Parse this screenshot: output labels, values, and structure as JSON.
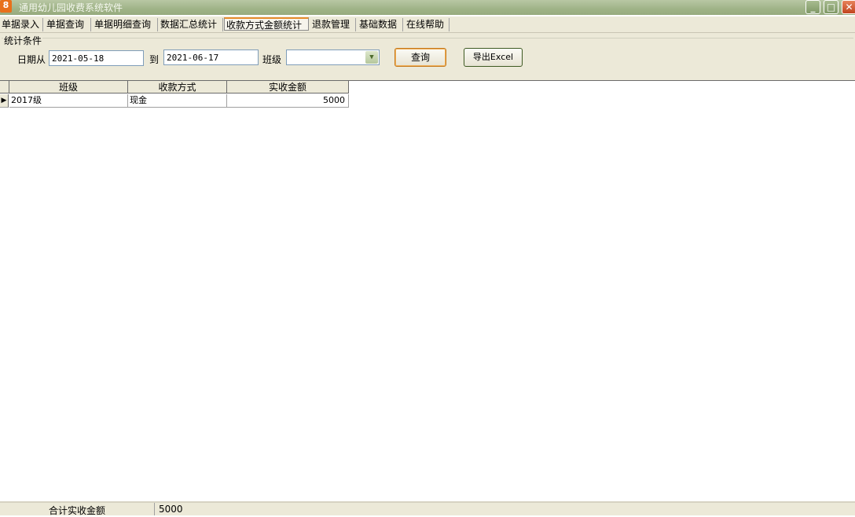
{
  "window": {
    "title": "通用幼儿园收费系统软件",
    "icon_glyph": "8",
    "controls": {
      "minimize": "_",
      "maximize": "□",
      "close": "✕"
    }
  },
  "tabs": [
    {
      "label": "单据录入",
      "active": false
    },
    {
      "label": "单据查询",
      "active": false
    },
    {
      "label": "单据明细查询",
      "active": false
    },
    {
      "label": "数据汇总统计",
      "active": false
    },
    {
      "label": "收款方式金额统计",
      "active": true
    },
    {
      "label": "退款管理",
      "active": false
    },
    {
      "label": "基础数据",
      "active": false
    },
    {
      "label": "在线帮助",
      "active": false
    }
  ],
  "filter": {
    "group_title": "统计条件",
    "date_from_label": "日期从",
    "date_from": "2021-05-18",
    "date_to_label": "到",
    "date_to": "2021-06-17",
    "class_label": "班级",
    "class_value": "",
    "query_button": "查询",
    "export_button": "导出Excel"
  },
  "table": {
    "columns": [
      "班级",
      "收款方式",
      "实收金额"
    ],
    "rows": [
      {
        "class": "2017级",
        "method": "现金",
        "amount": "5000"
      }
    ],
    "row_indicator": "▶"
  },
  "footer": {
    "total_label": "合计实收金额",
    "total_value": "5000"
  },
  "colors": {
    "titlebar": "#9fb387",
    "panel": "#ece9d8",
    "active_tab_accent": "#e68b2c"
  }
}
